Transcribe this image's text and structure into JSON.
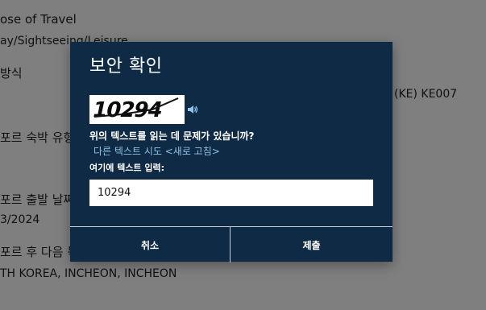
{
  "background": {
    "purpose_label": "ose of Travel",
    "purpose_value": "ay/Sightseeing/Leisure",
    "method_label": "방식",
    "flight_value": "(KE) KE007",
    "stay_label": "포르 숙박 유형",
    "departure_label": "포르 출발 날짜",
    "departure_value": "3/2024",
    "next_label": "포르 후 다음 목",
    "next_value": "TH KOREA, INCHEON, INCHEON"
  },
  "modal": {
    "title": "보안 확인",
    "captcha_text": "10294",
    "question": "위의 텍스트를 읽는 데 문제가 있습니까?",
    "refresh_link": "다른 텍스트 시도 <새로 고침>",
    "input_label": "여기에 텍스트 입력:",
    "input_value": "10294",
    "cancel_label": "취소",
    "submit_label": "제출"
  },
  "colors": {
    "modal_bg": "#0e2a44",
    "link": "#8fc3ea",
    "overlay": "#7f7f7f"
  },
  "icons": [
    "speaker-icon"
  ]
}
